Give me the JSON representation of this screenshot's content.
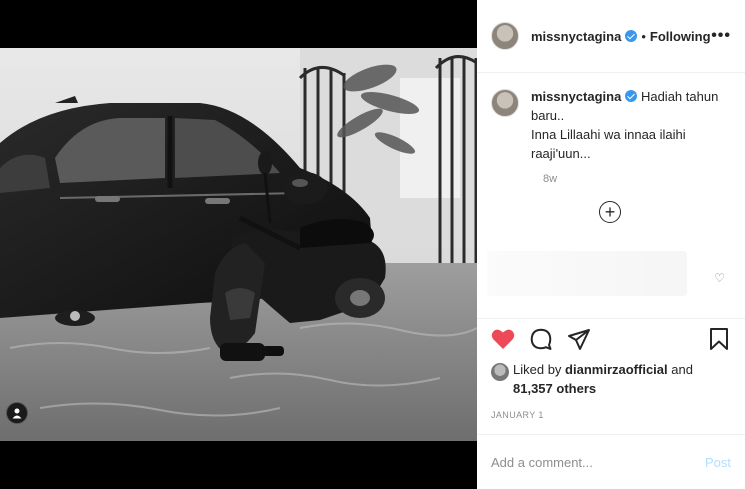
{
  "post": {
    "username": "missnyctagina",
    "follow_status": "Following",
    "separator": "•",
    "more_icon": "more-horizontal-icon",
    "more_label": "•••"
  },
  "caption": {
    "username": "missnyctagina",
    "line1": "Hadiah tahun baru..",
    "line2": "Inna Lillaahi wa innaa ilaihi raaji'uun...",
    "time_ago": "8w"
  },
  "load_more": {
    "label": "+"
  },
  "actions": {
    "like_icon": "heart-filled-icon",
    "comment_icon": "comment-icon",
    "share_icon": "share-icon",
    "save_icon": "bookmark-icon",
    "like_color": "#ed4956"
  },
  "likes": {
    "prefix": "Liked by",
    "user": "dianmirzaofficial",
    "and": "and",
    "count": "81,357 others"
  },
  "date": "JANUARY 1",
  "comment_input": {
    "placeholder": "Add a comment...",
    "post_label": "Post"
  },
  "colors": {
    "accent": "#3897f0",
    "post_disabled": "#b2dffc",
    "muted": "#8e8e8e"
  }
}
